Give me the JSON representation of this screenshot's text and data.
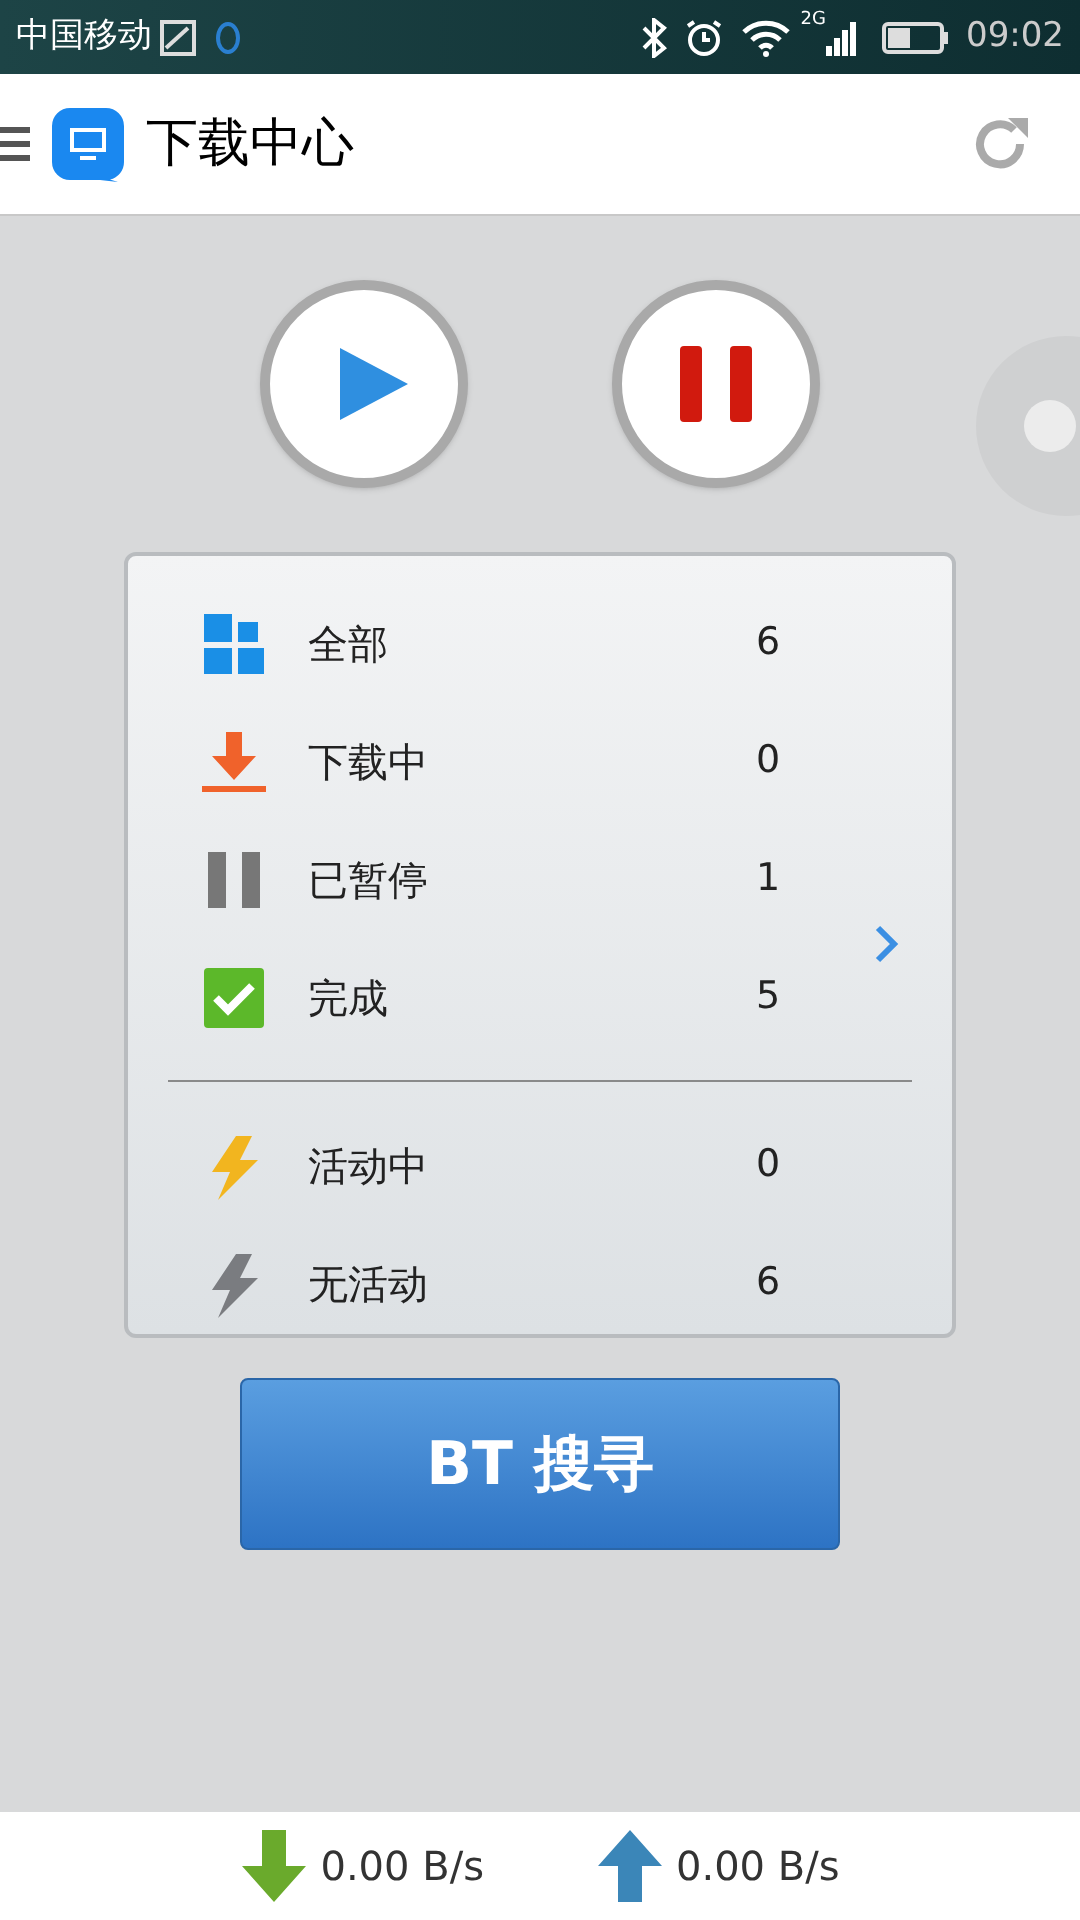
{
  "status_bar": {
    "carrier": "中国移动",
    "network": "2G",
    "time": "09:02"
  },
  "header": {
    "title": "下载中心"
  },
  "filter_groups": [
    [
      {
        "kind": "all",
        "label": "全部",
        "count": "6"
      },
      {
        "kind": "downloading",
        "label": "下载中",
        "count": "0"
      },
      {
        "kind": "paused",
        "label": "已暂停",
        "count": "1"
      },
      {
        "kind": "done",
        "label": "完成",
        "count": "5"
      }
    ],
    [
      {
        "kind": "active",
        "label": "活动中",
        "count": "0"
      },
      {
        "kind": "idle",
        "label": "无活动",
        "count": "6"
      }
    ]
  ],
  "search_button": "BT 搜寻",
  "speed": {
    "download": "0.00 B/s",
    "upload": "0.00 B/s"
  }
}
